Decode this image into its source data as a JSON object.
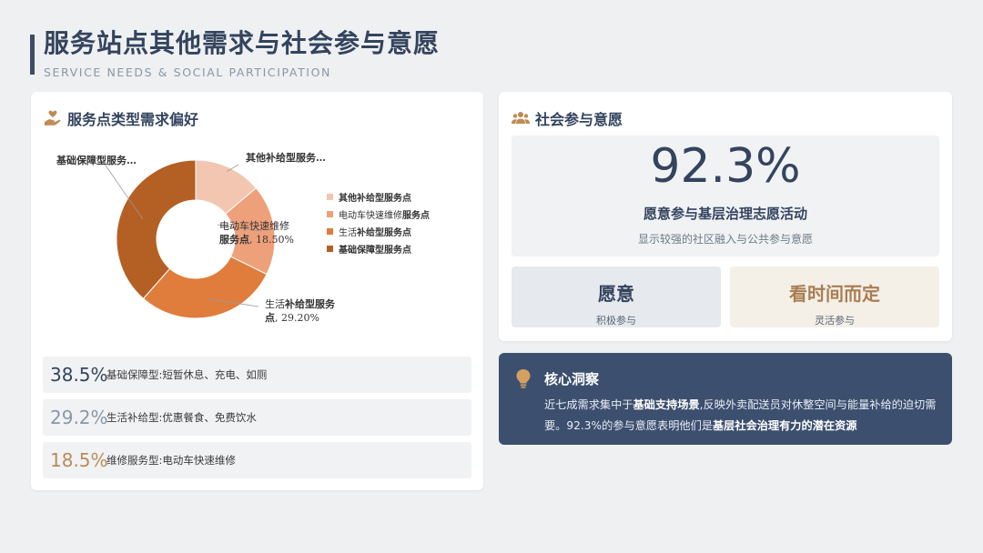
{
  "header": {
    "title": "服务站点其他需求与社会参与意愿",
    "subtitle": "SERVICE NEEDS & SOCIAL PARTICIPATION"
  },
  "left_card": {
    "title": "服务点类型需求偏好",
    "icon": "hand-heart-icon",
    "donut_labels": {
      "top_left": "基础保障型服务…",
      "top_right": "其他补给型服务…",
      "center_1": "电动车快速维修",
      "center_2_bold": "服务点",
      "center_2_rest": ", 18.50%",
      "bottom_1_plain": "生活",
      "bottom_1_bold": "补给型服务",
      "bottom_2_bold": "点",
      "bottom_2_rest": ", 29.20%"
    },
    "legend": [
      {
        "plain": "",
        "bold": "其他补给型服务点",
        "color": "#f2c6b0"
      },
      {
        "plain": "电动车快速维修",
        "bold": "服务点",
        "color": "#eea07a"
      },
      {
        "plain": "生活",
        "bold": "补给型服务点",
        "color": "#e07d3d"
      },
      {
        "plain": "",
        "bold": "基础保障型服务点",
        "color": "#b45f24"
      }
    ],
    "stats": [
      {
        "pct": "38.5%",
        "desc": "基础保障型:短暂休息、充电、如厕",
        "color": "#34445e"
      },
      {
        "pct": "29.2%",
        "desc": "生活补给型:优惠餐食、免费饮水",
        "color": "#8a97aa"
      },
      {
        "pct": "18.5%",
        "desc": "维修服务型:电动车快速维修",
        "color": "#b98c5a"
      }
    ]
  },
  "chart_data": {
    "type": "pie",
    "categories": [
      "其他补给型服务点",
      "电动车快速维修服务点",
      "生活补给型服务点",
      "基础保障型服务点"
    ],
    "values": [
      13.8,
      18.5,
      29.2,
      38.5
    ],
    "colors": [
      "#f2c6b0",
      "#eea07a",
      "#e07d3d",
      "#b45f24"
    ],
    "legend_position": "right"
  },
  "right_card": {
    "title": "社会参与意愿",
    "icon": "users-icon",
    "big_number": "92.3%",
    "big_label": "愿意参与基层治理志愿活动",
    "big_sub": "显示较强的社区融入与公共参与意愿",
    "option_a": {
      "title": "愿意",
      "sub": "积极参与",
      "bg": "#e6e9ee",
      "color": "#34445e"
    },
    "option_b": {
      "title": "看时间而定",
      "sub": "灵活参与",
      "bg": "#f4efe7",
      "color": "#a97e52"
    }
  },
  "insight": {
    "title": "核心洞察",
    "icon": "lightbulb-icon",
    "t1": "近七成需求集中于",
    "b1": "基础支持场景",
    "t2": ",反映外卖配送员对休整空间与能量补给的迫切需要。92.3%的参与意愿表明他们是",
    "b2": "基层社会治理有力的潜在资源"
  }
}
